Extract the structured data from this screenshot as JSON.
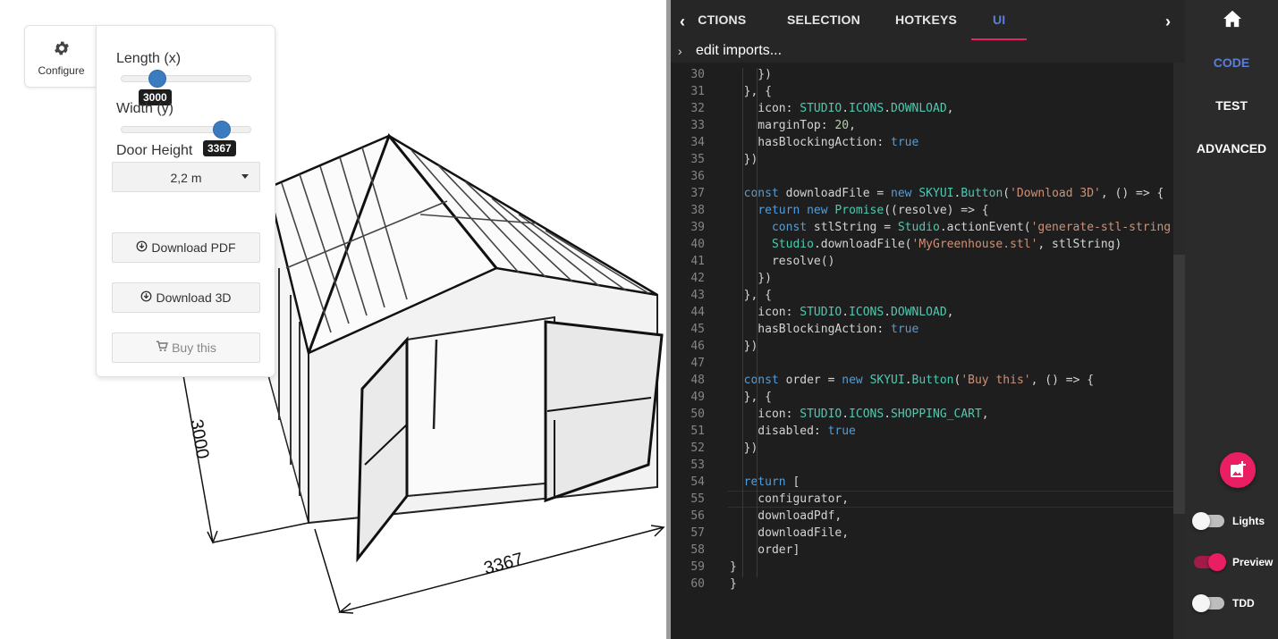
{
  "configurator": {
    "tab_label": "Configure",
    "length_label": "Length (x)",
    "length_value": "3000",
    "width_label": "Width (y)",
    "width_value": "3367",
    "door_label": "Door Height",
    "door_value": "2,2 m",
    "download_pdf": "Download PDF",
    "download_3d": "Download 3D",
    "buy": "Buy this"
  },
  "viewport": {
    "dim_length": "3000",
    "dim_width": "3367"
  },
  "editor": {
    "tabs": [
      "ACTIONS",
      "SELECTION",
      "HOTKEYS",
      "UI"
    ],
    "active_tab": "UI",
    "imports_label": "edit imports...",
    "lines": [
      {
        "n": "30",
        "t": "    })"
      },
      {
        "n": "31",
        "t": "  }, {"
      },
      {
        "n": "32",
        "t": "    icon: STUDIO.ICONS.DOWNLOAD,"
      },
      {
        "n": "33",
        "t": "    marginTop: 20,"
      },
      {
        "n": "34",
        "t": "    hasBlockingAction: true"
      },
      {
        "n": "35",
        "t": "  })"
      },
      {
        "n": "36",
        "t": ""
      },
      {
        "n": "37",
        "t": "  const downloadFile = new SKYUI.Button('Download 3D', () => {"
      },
      {
        "n": "38",
        "t": "    return new Promise((resolve) => {"
      },
      {
        "n": "39",
        "t": "      const stlString = Studio.actionEvent('generate-stl-string')"
      },
      {
        "n": "40",
        "t": "      Studio.downloadFile('MyGreenhouse.stl', stlString)"
      },
      {
        "n": "41",
        "t": "      resolve()"
      },
      {
        "n": "42",
        "t": "    })"
      },
      {
        "n": "43",
        "t": "  }, {"
      },
      {
        "n": "44",
        "t": "    icon: STUDIO.ICONS.DOWNLOAD,"
      },
      {
        "n": "45",
        "t": "    hasBlockingAction: true"
      },
      {
        "n": "46",
        "t": "  })"
      },
      {
        "n": "47",
        "t": ""
      },
      {
        "n": "48",
        "t": "  const order = new SKYUI.Button('Buy this', () => {"
      },
      {
        "n": "49",
        "t": "  }, {"
      },
      {
        "n": "50",
        "t": "    icon: STUDIO.ICONS.SHOPPING_CART,"
      },
      {
        "n": "51",
        "t": "    disabled: true"
      },
      {
        "n": "52",
        "t": "  })"
      },
      {
        "n": "53",
        "t": ""
      },
      {
        "n": "54",
        "t": "  return ["
      },
      {
        "n": "55",
        "t": "    configurator,"
      },
      {
        "n": "56",
        "t": "    downloadPdf,"
      },
      {
        "n": "57",
        "t": "    downloadFile,"
      },
      {
        "n": "58",
        "t": "    order]"
      },
      {
        "n": "59",
        "t": "}"
      },
      {
        "n": "60",
        "t": "}"
      }
    ]
  },
  "sidebar": {
    "items": [
      "CODE",
      "TEST",
      "ADVANCED"
    ],
    "active": "CODE",
    "toggles": [
      {
        "label": "Lights",
        "on": false
      },
      {
        "label": "Preview",
        "on": true
      },
      {
        "label": "TDD",
        "on": false
      }
    ]
  },
  "colors": {
    "accent": "#e91e63",
    "active_tab": "#5b7fd6",
    "slider": "#3a7cbf"
  }
}
